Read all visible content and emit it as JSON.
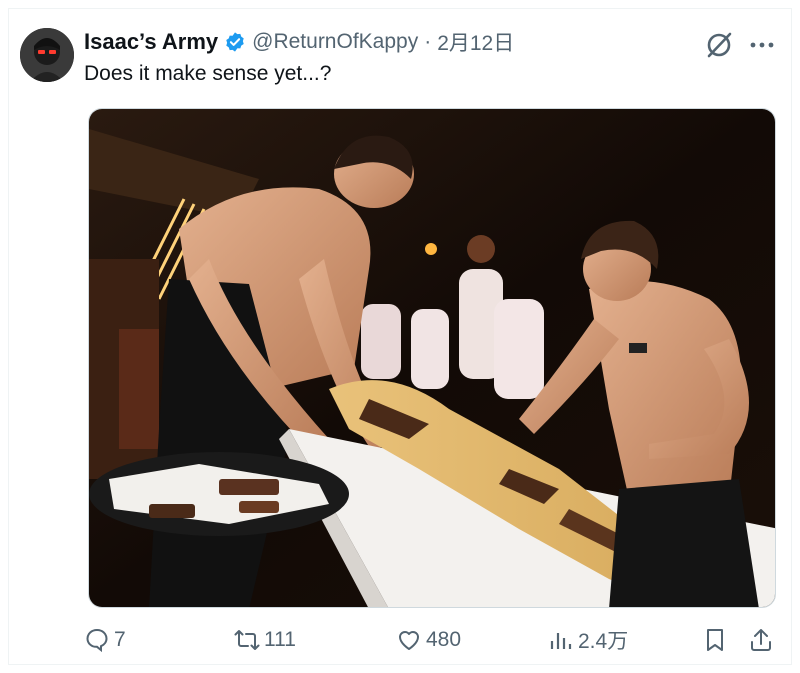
{
  "tweet": {
    "display_name": "Isaac’s Army",
    "handle": "@ReturnOfKappy",
    "separator": "·",
    "date": "2月12日",
    "text": "Does it make sense yet...?"
  },
  "actions": {
    "replies": "7",
    "retweets": "111",
    "likes": "480",
    "views": "2.4万"
  },
  "icons": {
    "verified": "verified-badge-icon",
    "grok": "grok-icon",
    "more": "more-options-icon",
    "reply": "reply-icon",
    "retweet": "retweet-icon",
    "like": "heart-icon",
    "views": "views-chart-icon",
    "bookmark": "bookmark-icon",
    "share": "share-icon"
  },
  "colors": {
    "accent": "#1d9bf0",
    "muted": "#536471",
    "text": "#0f1419"
  }
}
